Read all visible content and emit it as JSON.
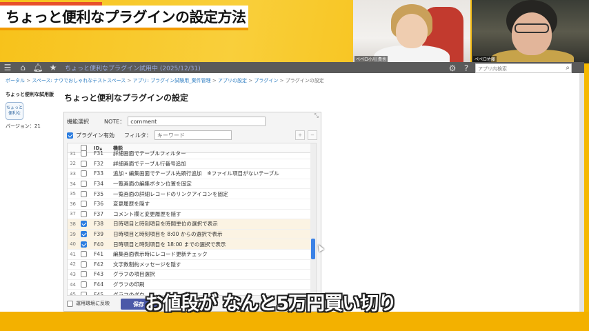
{
  "video": {
    "title": "ちょっと便利なプラグインの設定方法",
    "caption": "お値段が なんと5万円買い切り",
    "cam1_name": "ベペロ小川 貴也",
    "cam2_name": "ペペロ佐藤"
  },
  "topbar": {
    "menu_icon": "menu-icon",
    "home_icon": "home-icon",
    "bell_icon": "bell-icon",
    "star_icon": "star-icon",
    "app_title": "ちょっと便利なプラグイン試用中 (2025/12/31)",
    "search_placeholder": "アプリ内検索"
  },
  "breadcrumb": {
    "items": [
      "ポータル",
      "スペース: ナウでおしゃれなテストスペース",
      "アプリ: プラグイン試験用_案件管理",
      "アプリの設定",
      "プラグイン",
      "プラグインの設定"
    ],
    "sep": ">"
  },
  "sidebar": {
    "app_name": "ちょっと便利な試用版",
    "icon_text": "ちょっと\n便利な",
    "version": "バージョン：21"
  },
  "page": {
    "title": "ちょっと便利なプラグインの設定"
  },
  "panel": {
    "func_select_label": "機能選択",
    "note_label": "NOTE：",
    "note_value": "comment",
    "plugin_enabled_label": "プラグイン有効",
    "plugin_enabled": true,
    "filter_label": "フィルタ：",
    "filter_placeholder": "キーワード",
    "col_id": "ID",
    "col_id_sort": "▲",
    "col_function": "機能",
    "rows": [
      {
        "n": "31",
        "id": "F31",
        "fn": "詳細画面でテーブルフィルター",
        "on": false
      },
      {
        "n": "32",
        "id": "F32",
        "fn": "詳細画面でテーブル行番号追加",
        "on": false
      },
      {
        "n": "33",
        "id": "F33",
        "fn": "追加・編集画面でテーブル先頭行追加　※ファイル項目がないテーブル",
        "on": false
      },
      {
        "n": "34",
        "id": "F34",
        "fn": "一覧画面の編集ボタン位置を固定",
        "on": false
      },
      {
        "n": "35",
        "id": "F35",
        "fn": "一覧画面の詳細レコードのリンクアイコンを固定",
        "on": false
      },
      {
        "n": "36",
        "id": "F36",
        "fn": "変更履歴を隠す",
        "on": false
      },
      {
        "n": "37",
        "id": "F37",
        "fn": "コメント欄と変更履歴を隠す",
        "on": false
      },
      {
        "n": "38",
        "id": "F38",
        "fn": "日時項目と時刻項目を時間単位の選択で表示",
        "on": true
      },
      {
        "n": "39",
        "id": "F39",
        "fn": "日時項目と時刻項目を 8:00 からの選択で表示",
        "on": true
      },
      {
        "n": "40",
        "id": "F40",
        "fn": "日時項目と時刻項目を 18:00 までの選択で表示",
        "on": true
      },
      {
        "n": "41",
        "id": "F41",
        "fn": "編集画面表示時にレコード更新チェック",
        "on": false
      },
      {
        "n": "42",
        "id": "F42",
        "fn": "文字数制約メッセージを隠す",
        "on": false
      },
      {
        "n": "43",
        "id": "F43",
        "fn": "グラフの項目選択",
        "on": false
      },
      {
        "n": "44",
        "id": "F44",
        "fn": "グラフの印刷",
        "on": false
      },
      {
        "n": "45",
        "id": "F45",
        "fn": "グラフのダウ",
        "on": false
      }
    ],
    "apply_label": "運用環境に反映",
    "save_label": "保存"
  },
  "colors": {
    "frame_yellow": "#f5b800",
    "accent_blue": "#2b7de0",
    "save_button": "#4b59a8",
    "topbar": "#5a5a5a",
    "link": "#2a7bc1"
  }
}
